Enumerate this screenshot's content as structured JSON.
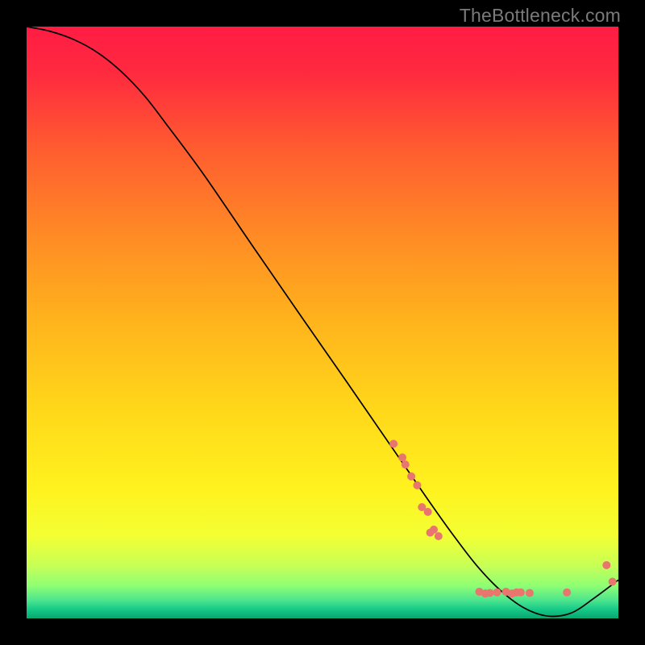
{
  "watermark": "TheBottleneck.com",
  "chart_data": {
    "type": "line",
    "title": "",
    "xlabel": "",
    "ylabel": "",
    "xlim": [
      0,
      100
    ],
    "ylim": [
      0,
      100
    ],
    "grid": false,
    "background_gradient": {
      "direction": "vertical",
      "stops": [
        {
          "offset": 0.0,
          "color": "#ff1c44"
        },
        {
          "offset": 0.08,
          "color": "#ff2a3f"
        },
        {
          "offset": 0.2,
          "color": "#ff5a30"
        },
        {
          "offset": 0.35,
          "color": "#ff8a25"
        },
        {
          "offset": 0.5,
          "color": "#ffb41c"
        },
        {
          "offset": 0.65,
          "color": "#ffd81a"
        },
        {
          "offset": 0.78,
          "color": "#fff21e"
        },
        {
          "offset": 0.86,
          "color": "#f3ff33"
        },
        {
          "offset": 0.91,
          "color": "#c8ff55"
        },
        {
          "offset": 0.945,
          "color": "#8fff74"
        },
        {
          "offset": 0.97,
          "color": "#4be38e"
        },
        {
          "offset": 0.985,
          "color": "#15c987"
        },
        {
          "offset": 1.0,
          "color": "#0aa66f"
        }
      ]
    },
    "series": [
      {
        "name": "bottleneck-curve",
        "color": "#000000",
        "stroke_width": 1.7,
        "x": [
          0,
          4,
          8,
          12,
          16,
          20,
          24,
          30,
          38,
          46,
          54,
          62,
          68,
          72,
          76,
          80,
          84,
          88,
          92,
          96,
          100
        ],
        "values": [
          100,
          99.2,
          97.8,
          95.6,
          92.4,
          88.2,
          83.0,
          74.9,
          63.2,
          51.6,
          40.1,
          28.5,
          19.8,
          14.2,
          9.0,
          4.8,
          1.8,
          0.4,
          0.9,
          3.5,
          6.5
        ]
      }
    ],
    "points": {
      "color": "#e9766e",
      "radius": 5.0,
      "items": [
        {
          "x": 62.0,
          "y": 29.5
        },
        {
          "x": 63.5,
          "y": 27.2
        },
        {
          "x": 64.0,
          "y": 26.0
        },
        {
          "x": 65.0,
          "y": 24.0
        },
        {
          "x": 66.0,
          "y": 22.5
        },
        {
          "x": 66.8,
          "y": 18.8
        },
        {
          "x": 67.8,
          "y": 18.0
        },
        {
          "x": 68.2,
          "y": 14.5
        },
        {
          "x": 68.8,
          "y": 15.0
        },
        {
          "x": 69.6,
          "y": 13.9
        },
        {
          "x": 76.5,
          "y": 4.5
        },
        {
          "x": 77.5,
          "y": 4.2
        },
        {
          "x": 78.3,
          "y": 4.3
        },
        {
          "x": 79.5,
          "y": 4.4
        },
        {
          "x": 81.0,
          "y": 4.5
        },
        {
          "x": 82.0,
          "y": 4.2
        },
        {
          "x": 82.8,
          "y": 4.4
        },
        {
          "x": 83.5,
          "y": 4.4
        },
        {
          "x": 85.0,
          "y": 4.3
        },
        {
          "x": 91.3,
          "y": 4.4
        },
        {
          "x": 98.0,
          "y": 9.0
        },
        {
          "x": 99.0,
          "y": 6.2
        }
      ]
    }
  }
}
